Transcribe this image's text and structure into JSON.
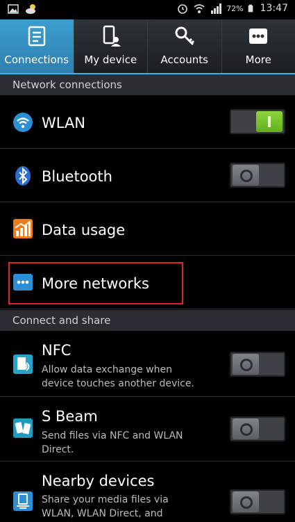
{
  "status_bar": {
    "battery_percent": "72%",
    "time": "13:47"
  },
  "tabs": [
    {
      "label": "Connections",
      "icon": "connections-icon"
    },
    {
      "label": "My device",
      "icon": "device-icon"
    },
    {
      "label": "Accounts",
      "icon": "key-icon"
    },
    {
      "label": "More",
      "icon": "more-icon"
    }
  ],
  "sections": {
    "network": "Network connections",
    "connect": "Connect and share"
  },
  "items": {
    "wlan": {
      "title": "WLAN",
      "toggle": "on"
    },
    "bluetooth": {
      "title": "Bluetooth",
      "toggle": "off"
    },
    "data_usage": {
      "title": "Data usage"
    },
    "more_networks": {
      "title": "More networks"
    },
    "nfc": {
      "title": "NFC",
      "sub1": "Allow data exchange when",
      "sub2": "device touches another device.",
      "toggle": "off"
    },
    "sbeam": {
      "title": "S Beam",
      "sub1": "Send files via NFC and WLAN",
      "sub2": "Direct.",
      "toggle": "off"
    },
    "nearby": {
      "title": "Nearby devices",
      "sub1": "Share your media files via",
      "sub2": "WLAN, WLAN Direct, and",
      "toggle": "off"
    }
  },
  "colors": {
    "accent": "#33b5e5",
    "highlight": "#e0232d",
    "toggle_on": "#7cc72d"
  }
}
